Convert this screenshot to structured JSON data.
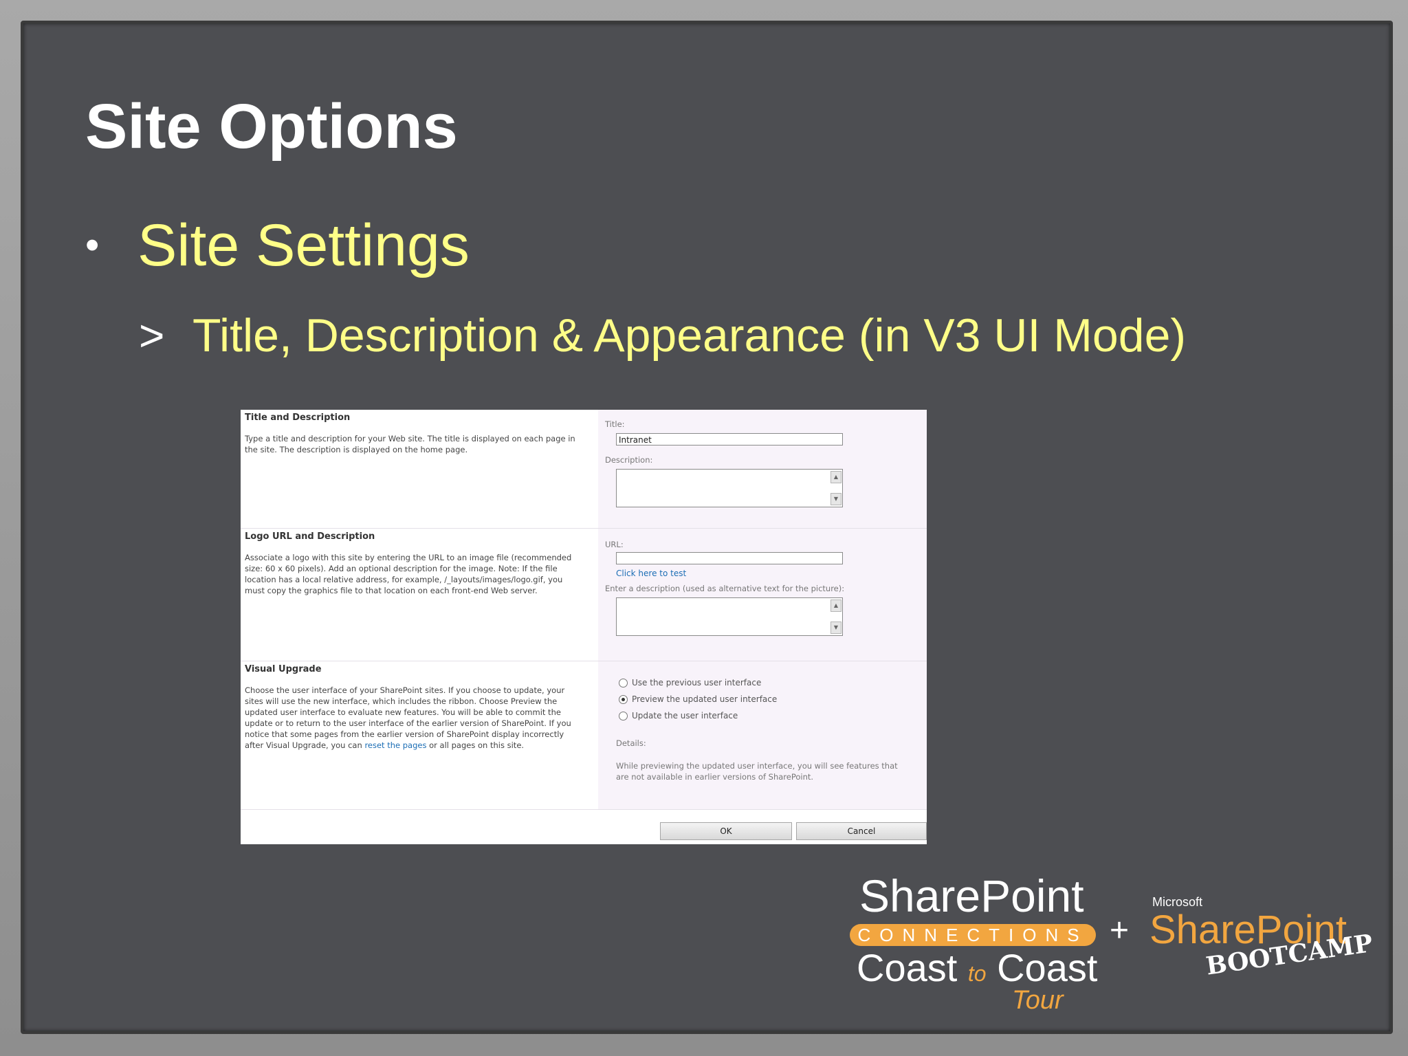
{
  "slide": {
    "title": "Site Options",
    "bullet": "Site Settings",
    "sub_marker": ">",
    "sub_bullet": "Title, Description & Appearance (in V3 UI Mode)"
  },
  "screenshot": {
    "title_section": {
      "heading": "Title and Description",
      "description": "Type a title and description for your Web site. The title is displayed on each page in the site. The description is displayed on the home page.",
      "title_label": "Title:",
      "title_value": "Intranet",
      "description_label": "Description:"
    },
    "logo_section": {
      "heading": "Logo URL and Description",
      "description": "Associate a logo with this site by entering the URL to an image file (recommended size: 60 x 60 pixels). Add an optional description for the image. Note: If the file location has a local relative address, for example, /_layouts/images/logo.gif, you must copy the graphics file to that location on each front-end Web server.",
      "url_label": "URL:",
      "test_link": "Click here to test",
      "alt_label": "Enter a description (used as alternative text for the picture):"
    },
    "upgrade_section": {
      "heading": "Visual Upgrade",
      "description_before_link": "Choose the user interface of your SharePoint sites. If you choose to update, your sites will use the new interface, which includes the ribbon. Choose Preview the updated user interface to evaluate new features. You will be able to commit the update or to return to the user interface of the earlier version of SharePoint. If you notice that some pages from the earlier version of SharePoint display incorrectly after Visual Upgrade, you can ",
      "reset_link": "reset the pages",
      "description_after_link": " or all pages on this site.",
      "options": [
        {
          "label": "Use the previous user interface",
          "selected": false
        },
        {
          "label": "Preview the updated user interface",
          "selected": true
        },
        {
          "label": "Update the user interface",
          "selected": false
        }
      ],
      "details_label": "Details:",
      "details_text": "While previewing the updated user interface, you will see features that are not available in earlier versions of SharePoint."
    },
    "buttons": {
      "ok": "OK",
      "cancel": "Cancel"
    }
  },
  "logos": {
    "sharepoint": "SharePoint",
    "connections": "CONNECTIONS",
    "coast_left": "Coast",
    "coast_to": "to",
    "coast_right": "Coast",
    "tour": "Tour",
    "plus": "+",
    "microsoft": "Microsoft",
    "bootcamp_sharepoint": "SharePoint",
    "bootcamp": "BOOTCAMP"
  },
  "colors": {
    "slide_bg": "#4d4e52",
    "title": "#ffffff",
    "bullet_text": "#ffff88",
    "accent_orange": "#f2a640",
    "link": "#1c6eb5"
  }
}
